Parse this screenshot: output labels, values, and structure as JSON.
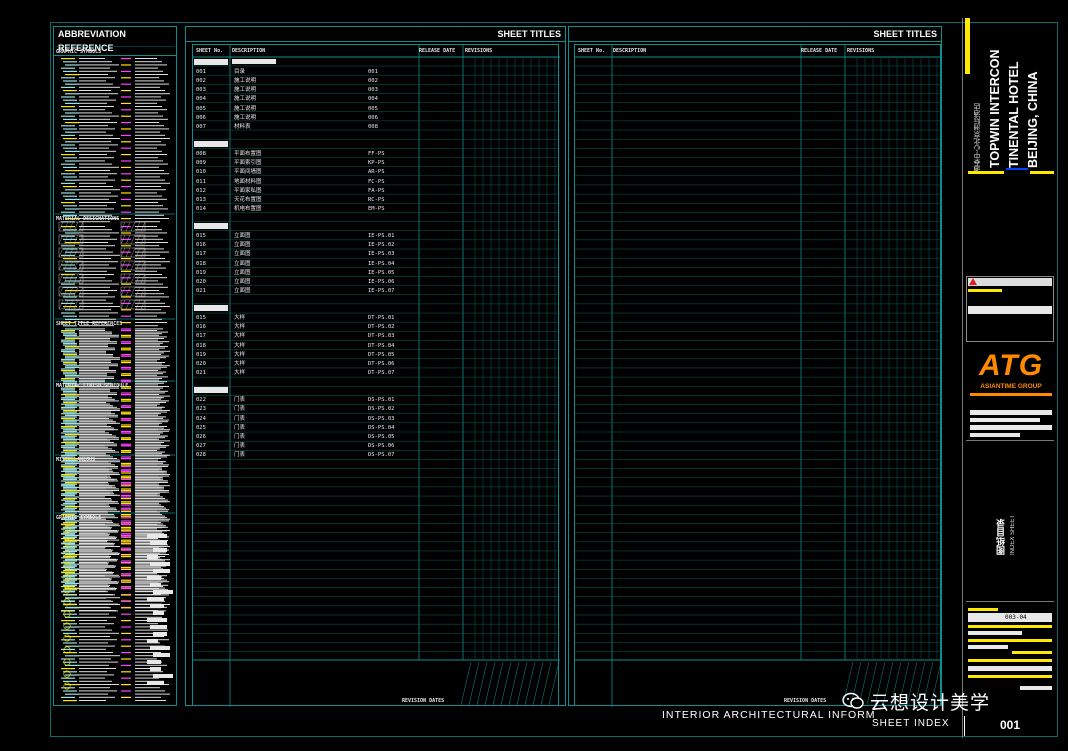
{
  "left_panel": {
    "title": "ABBREVIATION REFERENCE",
    "sections": [
      {
        "title": "GRAPHIC SYMBOLS"
      },
      {
        "title": "MATERIAL DESIGNATIONS"
      },
      {
        "title": "SHEET TITLE REFERENCES"
      },
      {
        "title": "MATERIAL FINISH SCHEDULE"
      },
      {
        "title": "MISCELLANEOUS"
      },
      {
        "title": "GRAPHIC SYMBOLS"
      }
    ]
  },
  "sheet_panels": [
    {
      "title": "SHEET TITLES",
      "columns": [
        "SHEET No.",
        "DESCRIPTION",
        "RELEASE DATE",
        "REVISIONS"
      ],
      "groups": [
        {
          "heading": "",
          "rows": [
            {
              "no": "001",
              "desc": "目录",
              "code": "001"
            },
            {
              "no": "002",
              "desc": "施工说明",
              "code": "002"
            },
            {
              "no": "003",
              "desc": "施工说明",
              "code": "003"
            },
            {
              "no": "004",
              "desc": "施工说明",
              "code": "004"
            },
            {
              "no": "005",
              "desc": "施工说明",
              "code": "005"
            },
            {
              "no": "006",
              "desc": "施工说明",
              "code": "006"
            },
            {
              "no": "007",
              "desc": "材料表",
              "code": "008"
            }
          ]
        },
        {
          "heading": "",
          "rows": [
            {
              "no": "008",
              "desc": "平面布置图",
              "code": "FF-PS"
            },
            {
              "no": "009",
              "desc": "平面索引图",
              "code": "KP-PS"
            },
            {
              "no": "010",
              "desc": "平面间墙图",
              "code": "AR-PS"
            },
            {
              "no": "011",
              "desc": "地面材料图",
              "code": "FC-PS"
            },
            {
              "no": "012",
              "desc": "平面家私图",
              "code": "FA-PS"
            },
            {
              "no": "013",
              "desc": "天花布置图",
              "code": "RC-PS"
            },
            {
              "no": "014",
              "desc": "机电布置图",
              "code": "EM-PS"
            }
          ]
        },
        {
          "heading": "",
          "rows": [
            {
              "no": "015",
              "desc": "立面图",
              "code": "IE-PS.01"
            },
            {
              "no": "016",
              "desc": "立面图",
              "code": "IE-PS.02"
            },
            {
              "no": "017",
              "desc": "立面图",
              "code": "IE-PS.03"
            },
            {
              "no": "018",
              "desc": "立面图",
              "code": "IE-PS.04"
            },
            {
              "no": "019",
              "desc": "立面图",
              "code": "IE-PS.05"
            },
            {
              "no": "020",
              "desc": "立面图",
              "code": "IE-PS.06"
            },
            {
              "no": "021",
              "desc": "立面图",
              "code": "IE-PS.07"
            }
          ]
        },
        {
          "heading": "",
          "rows": [
            {
              "no": "015",
              "desc": "大样",
              "code": "DT-PS.01"
            },
            {
              "no": "016",
              "desc": "大样",
              "code": "DT-PS.02"
            },
            {
              "no": "017",
              "desc": "大样",
              "code": "DT-PS.03"
            },
            {
              "no": "018",
              "desc": "大样",
              "code": "DT-PS.04"
            },
            {
              "no": "019",
              "desc": "大样",
              "code": "DT-PS.05"
            },
            {
              "no": "020",
              "desc": "大样",
              "code": "DT-PS.06"
            },
            {
              "no": "021",
              "desc": "大样",
              "code": "DT-PS.07"
            }
          ]
        },
        {
          "heading": "",
          "rows": [
            {
              "no": "022",
              "desc": "门表",
              "code": "DS-PS.01"
            },
            {
              "no": "023",
              "desc": "门表",
              "code": "DS-PS.02"
            },
            {
              "no": "024",
              "desc": "门表",
              "code": "DS-PS.03"
            },
            {
              "no": "025",
              "desc": "门表",
              "code": "DS-PS.04"
            },
            {
              "no": "026",
              "desc": "门表",
              "code": "DS-PS.05"
            },
            {
              "no": "027",
              "desc": "门表",
              "code": "DS-PS.06"
            },
            {
              "no": "028",
              "desc": "门表",
              "code": "DS-PS.07"
            }
          ]
        }
      ],
      "footer": "REVISION DATES"
    },
    {
      "title": "SHEET TITLES",
      "columns": [
        "SHEET No.",
        "DESCRIPTION",
        "RELEASE DATE",
        "REVISIONS"
      ],
      "groups": [],
      "footer": "REVISION DATES"
    }
  ],
  "title_block": {
    "project_en": "TOPWIN INTERCON TINENTAL HOTEL BEIJING, CHINA",
    "project_cn": "通泰中心北京洲际酒店",
    "logo": "ATG",
    "logo_sub": "ASIANTIME GROUP",
    "sheet_title_cn": "图纸目录",
    "sheet_title_en": "INDEX SHEET",
    "date": "003-04",
    "sheet_number": "001"
  },
  "bottom_bar": {
    "left_text": "INTERIOR ARCHITECTURAL INFORM",
    "sheet_index_label": "SHEET INDEX",
    "watermark": "云想设计美学"
  },
  "colors": {
    "frame": "#0e8f8f",
    "accent_yellow": "#ffe800",
    "accent_blue": "#0044ff",
    "logo_orange": "#ff8a00"
  }
}
